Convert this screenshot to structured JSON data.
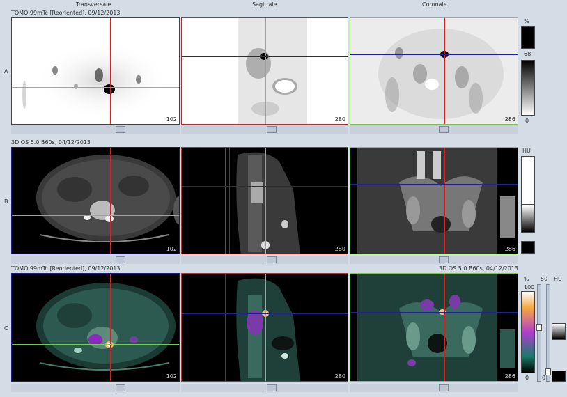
{
  "columns": {
    "transversale": "Transversale",
    "sagittale": "Sagittale",
    "coronale": "Coronale"
  },
  "rows": {
    "a": {
      "letter": "A",
      "header": "TOMO 99mTc [Reoriented], 09/12/2013"
    },
    "b": {
      "letter": "B",
      "header": "3D OS 5.0 B60s, 04/12/2013"
    },
    "c": {
      "letter": "C",
      "header_left": "TOMO 99mTc [Reoriented], 09/12/2013",
      "header_right": "3D OS 5.0 B60s, 04/12/2013"
    }
  },
  "slices": {
    "transversale": "102",
    "sagittale": "280",
    "coronale": "286"
  },
  "scale_a": {
    "unit": "%",
    "marker": "68",
    "min": "0"
  },
  "scale_b": {
    "unit": "HU"
  },
  "scale_c": {
    "unit": "%",
    "max": "100",
    "min": "0",
    "threshold": "50",
    "hu_unit": "HU",
    "hu_min": "0"
  },
  "colors": {
    "transversale_frame": "#1a1a8c",
    "sagittale_frame": "#b03030",
    "coronale_frame": "#7fc24f",
    "crosshair_vertical_transversale": "#d52020",
    "crosshair_horizontal_transversale": "#6bd14a",
    "crosshair_vertical_sagittale": "#6bd14a",
    "crosshair_horizontal_sagittale": "#2020a0",
    "crosshair_vertical_coronale": "#d52020",
    "crosshair_horizontal_coronale": "#2020a0"
  }
}
